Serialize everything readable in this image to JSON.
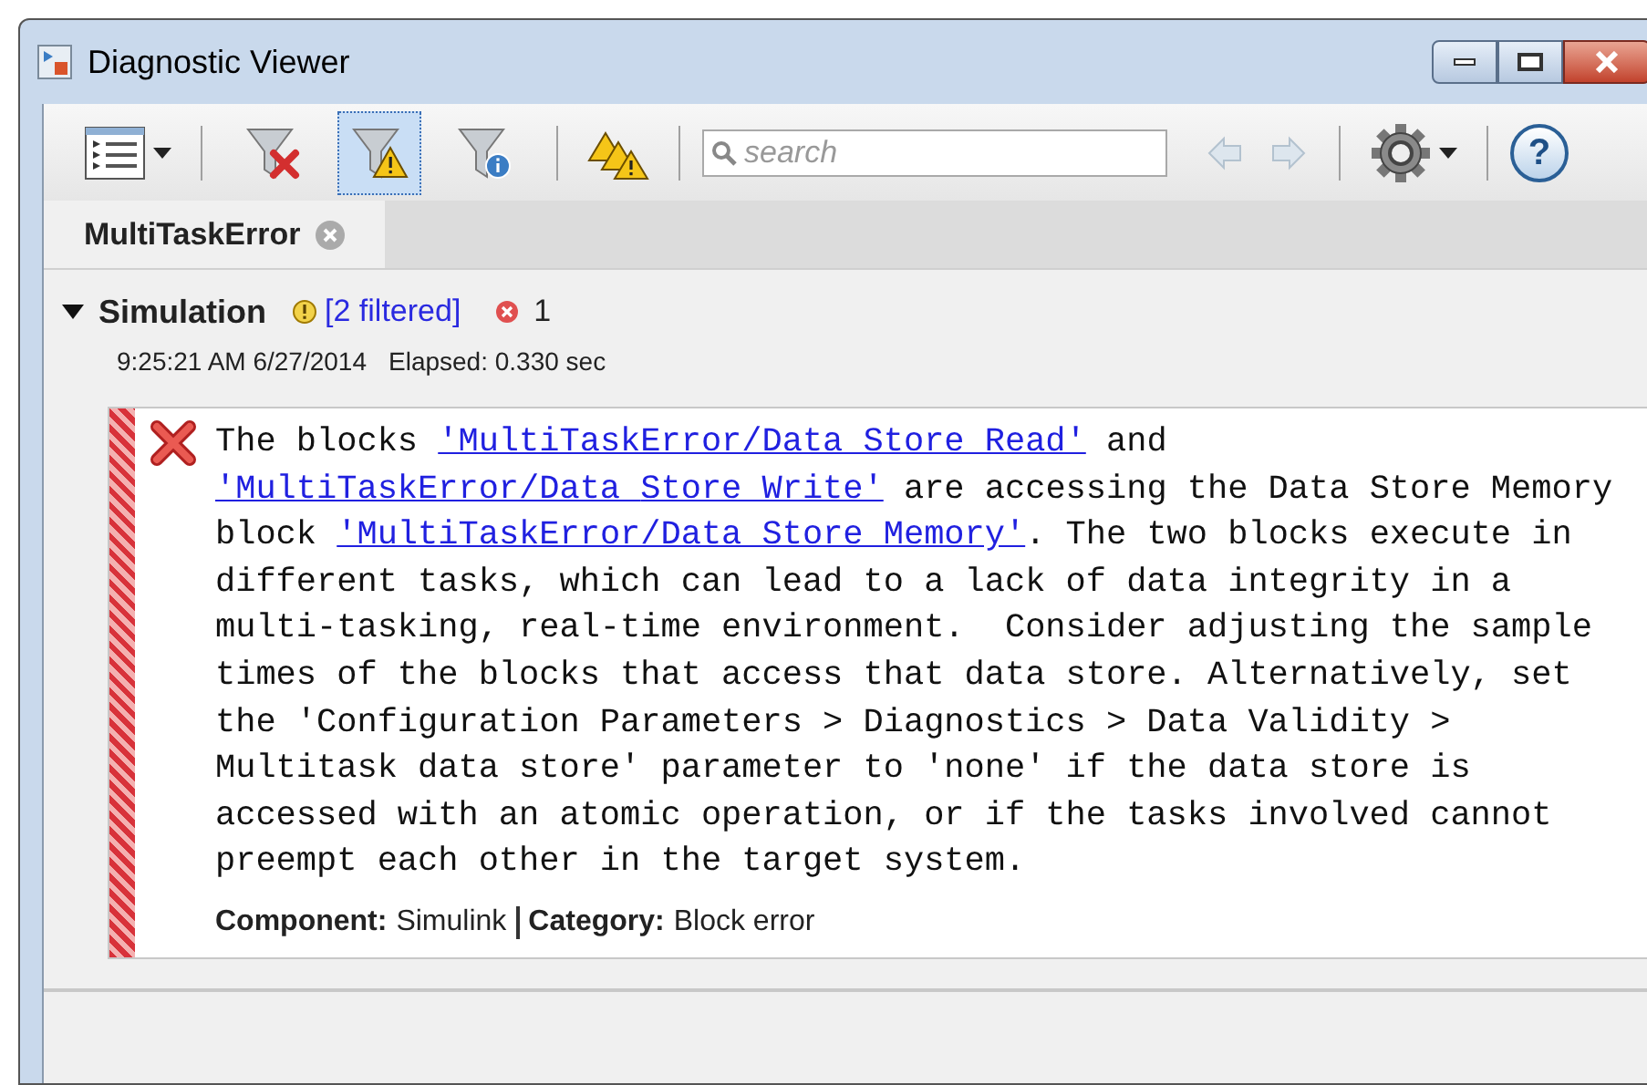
{
  "window": {
    "title": "Diagnostic Viewer"
  },
  "toolbar": {
    "filters": [
      {
        "kind": "error",
        "selected": false
      },
      {
        "kind": "warning",
        "selected": true
      },
      {
        "kind": "info",
        "selected": false
      }
    ],
    "search": {
      "placeholder": "search"
    },
    "nav": [
      {
        "kind": "back",
        "disabled": true
      },
      {
        "kind": "forward",
        "disabled": true
      }
    ],
    "help": "?"
  },
  "tabs": [
    {
      "label": "MultiTaskError",
      "selected": true
    }
  ],
  "group": {
    "name": "Simulation",
    "expanded": true,
    "filtered": "[2 filtered]",
    "error_count": "1",
    "timestamp": "9:25:21 AM 6/27/2014",
    "elapsed": "Elapsed: 0.330 sec",
    "message": {
      "segments": [
        {
          "kind": "text",
          "text": "The blocks "
        },
        {
          "kind": "link",
          "text": "'MultiTaskError/Data Store Read'"
        },
        {
          "kind": "text",
          "text": " and "
        },
        {
          "kind": "link",
          "text": "'MultiTaskError/Data "
        },
        {
          "kind": "link",
          "text": "Store Write'"
        },
        {
          "kind": "text",
          "text": " are accessing the Data Store Memory block "
        },
        {
          "kind": "link",
          "text": "'MultiTaskError/Data Store Memory'"
        },
        {
          "kind": "text",
          "text": ". The two blocks execute in different tasks, which can lead to a lack of data integrity in a multi-tasking, real-time environment.  Consider adjusting the sample times of the blocks that access that data store. Alternatively, set the 'Configuration Parameters > Diagnostics > Data Validity > Multitask data store' parameter to 'none' if the data store is accessed with an atomic operation, or if the tasks involved cannot preempt each other in the target system."
        }
      ],
      "footer": [
        {
          "label": "Component:",
          "value": "Simulink"
        },
        {
          "label": "Category:",
          "value": "Block error"
        }
      ]
    }
  }
}
